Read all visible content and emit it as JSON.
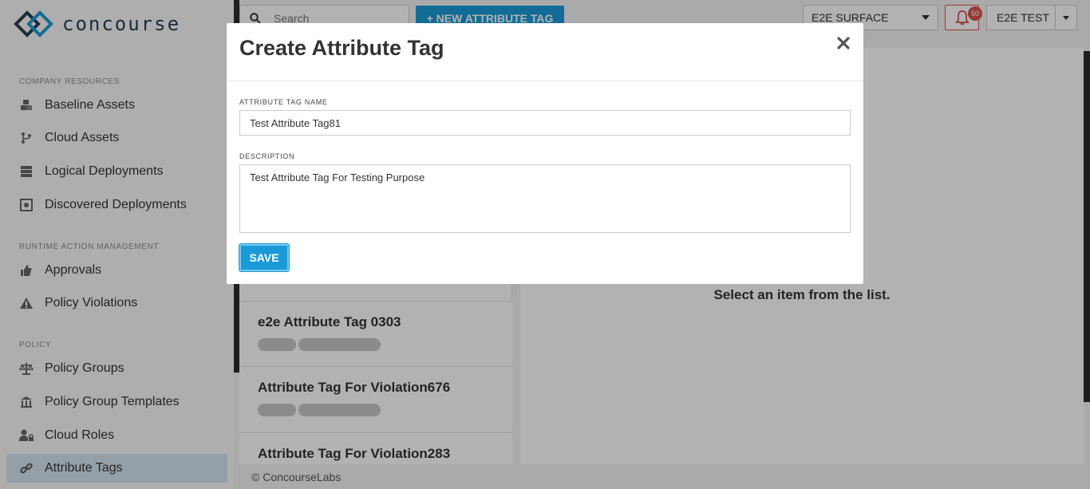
{
  "app": {
    "logo_text": "concourse"
  },
  "sidebar": {
    "sections": [
      {
        "title": "COMPANY RESOURCES",
        "items": [
          {
            "label": "Baseline Assets",
            "icon": "cubes-icon"
          },
          {
            "label": "Cloud Assets",
            "icon": "branch-icon"
          },
          {
            "label": "Logical Deployments",
            "icon": "server-icon"
          },
          {
            "label": "Discovered Deployments",
            "icon": "discover-icon"
          }
        ]
      },
      {
        "title": "RUNTIME ACTION MANAGEMENT",
        "items": [
          {
            "label": "Approvals",
            "icon": "thumbs-up-icon"
          },
          {
            "label": "Policy Violations",
            "icon": "warning-icon"
          }
        ]
      },
      {
        "title": "POLICY",
        "items": [
          {
            "label": "Policy Groups",
            "icon": "balance-scale-icon"
          },
          {
            "label": "Policy Group Templates",
            "icon": "institution-icon"
          },
          {
            "label": "Cloud Roles",
            "icon": "user-lock-icon"
          },
          {
            "label": "Attribute Tags",
            "icon": "link-icon",
            "active": true
          }
        ]
      }
    ]
  },
  "topbar": {
    "search_placeholder": "Search",
    "new_button": "+ NEW ATTRIBUTE TAG",
    "surface": "E2E SURFACE",
    "notifications_count": "50",
    "user": "E2E TEST"
  },
  "list": {
    "items": [
      {
        "title": "e2e Attribute Tag 0303"
      },
      {
        "title": "Attribute Tag For Violation676"
      },
      {
        "title": "Attribute Tag For Violation283"
      }
    ]
  },
  "detail": {
    "empty_message": "Select an item from the list."
  },
  "footer": {
    "text": "© ConcourseLabs"
  },
  "modal": {
    "title": "Create Attribute Tag",
    "name_label": "ATTRIBUTE TAG NAME",
    "name_value": "Test Attribute Tag81",
    "description_label": "DESCRIPTION",
    "description_value": "Test Attribute Tag For Testing Purpose",
    "save_label": "SAVE"
  },
  "colors": {
    "accent": "#1a9bd7",
    "danger": "#d9534f",
    "active_nav": "#d6e4f0"
  }
}
